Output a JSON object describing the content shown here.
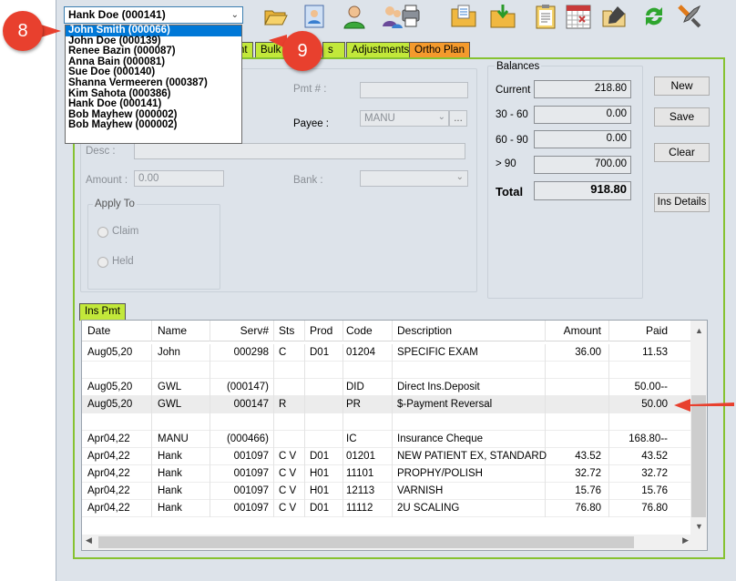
{
  "patient_combo": {
    "value": "Hank Doe (000141)",
    "chevron_icon": "chevron-down-icon"
  },
  "patient_dropdown": [
    {
      "label": "John Smith (000066)",
      "selected": true
    },
    {
      "label": "John Doe (000139)",
      "selected": false
    },
    {
      "label": "Renee Bazin (000087)",
      "selected": false
    },
    {
      "label": "Anna Bain (000081)",
      "selected": false
    },
    {
      "label": "Sue Doe (000140)",
      "selected": false
    },
    {
      "label": "Shanna Vermeeren (000387)",
      "selected": false
    },
    {
      "label": "Kim Sahota (000386)",
      "selected": false
    },
    {
      "label": "Hank Doe (000141)",
      "selected": false
    },
    {
      "label": "Bob Mayhew (000002)",
      "selected": false
    },
    {
      "label": "Bob Mayhew (000002)",
      "selected": false
    }
  ],
  "callouts": {
    "first": "8",
    "second": "9"
  },
  "toolbar_icons": [
    "folder-open-icon",
    "patient-card-icon",
    "person-icon",
    "family-print-icon",
    "folder-docs-icon",
    "folder-download-icon",
    "clipboard-icon",
    "calendar-icon",
    "folder-edit-icon",
    "refresh-icon",
    "tools-icon"
  ],
  "tabs": {
    "tab_a": "nt",
    "tab_bulk": "Bulk",
    "tab_c": "s",
    "tab_adjustments": "Adjustments",
    "tab_ortho": "Ortho Plan"
  },
  "form": {
    "pmt_label": "Pmt # :",
    "payee_label": "Payee :",
    "payee_value": "MANU",
    "payee_more": "...",
    "desc_label": "Desc :",
    "amount_label": "Amount :",
    "amount_value": "0.00",
    "bank_label": "Bank :",
    "apply_to_label": "Apply To",
    "claim_label": "Claim",
    "held_label": "Held"
  },
  "balances": {
    "title": "Balances",
    "current_label": "Current",
    "current_value": "218.80",
    "b30_label": "30 - 60",
    "b30_value": "0.00",
    "b60_label": "60 - 90",
    "b60_value": "0.00",
    "b90_label": "> 90",
    "b90_value": "700.00",
    "total_label": "Total",
    "total_value": "918.80"
  },
  "buttons": {
    "new": "New",
    "save": "Save",
    "clear": "Clear",
    "ins_details": "Ins Details"
  },
  "ins_pmt_tab": "Ins Pmt",
  "table": {
    "headers": [
      "Date",
      "Name",
      "Serv#",
      "Sts",
      "Prod",
      "Code",
      "Description",
      "Amount",
      "Paid"
    ],
    "rows": [
      [
        "Aug05,20",
        "John",
        "000298",
        "C",
        "D01",
        "01204",
        "SPECIFIC EXAM",
        "36.00",
        "11.53"
      ],
      [
        "",
        "",
        "",
        "",
        "",
        "",
        "",
        "",
        ""
      ],
      [
        "Aug05,20",
        "GWL",
        "(000147)",
        "",
        "",
        "DID",
        "Direct Ins.Deposit",
        "",
        "50.00--"
      ],
      [
        "Aug05,20",
        "GWL",
        "000147",
        "R",
        "",
        "PR",
        "$-Payment Reversal",
        "",
        "50.00"
      ],
      [
        "",
        "",
        "",
        "",
        "",
        "",
        "",
        "",
        ""
      ],
      [
        "Apr04,22",
        "MANU",
        "(000466)",
        "",
        "",
        "IC",
        "Insurance Cheque",
        "",
        "168.80--"
      ],
      [
        "Apr04,22",
        "Hank",
        "001097",
        "C V",
        "D01",
        "01201",
        "NEW PATIENT EX, STANDARD",
        "43.52",
        "43.52"
      ],
      [
        "Apr04,22",
        "Hank",
        "001097",
        "C V",
        "H01",
        "11101",
        "PROPHY/POLISH",
        "32.72",
        "32.72"
      ],
      [
        "Apr04,22",
        "Hank",
        "001097",
        "C V",
        "H01",
        "12113",
        "VARNISH",
        "15.76",
        "15.76"
      ],
      [
        "Apr04,22",
        "Hank",
        "001097",
        "C V",
        "D01",
        "11112",
        "2U SCALING",
        "76.80",
        "76.80"
      ]
    ],
    "highlighted_row": 3
  },
  "colors": {
    "accent_green": "#86c231",
    "tab_green": "#c2e83a",
    "tab_orange": "#f49a2c",
    "callout_red": "#e8402e",
    "selection_blue": "#0078d7"
  }
}
